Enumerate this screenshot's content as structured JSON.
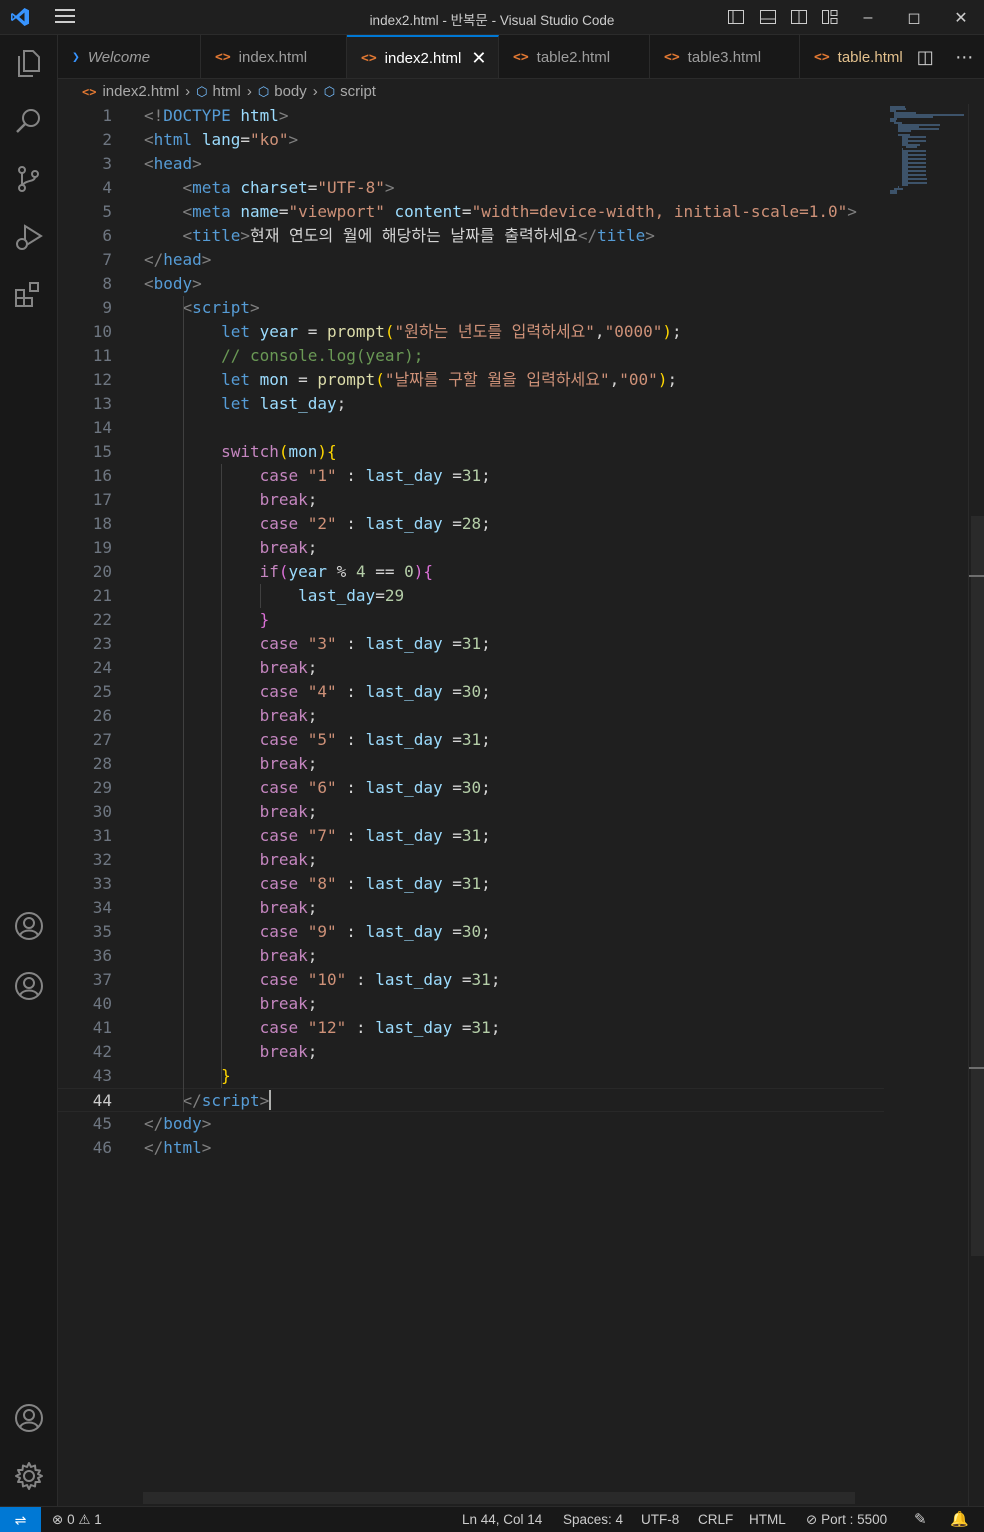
{
  "window": {
    "title": "index2.html - 반복문 - Visual Studio Code"
  },
  "tabs": [
    {
      "label": "Welcome",
      "icon": "vscode-icon"
    },
    {
      "label": "index.html",
      "icon": "html-icon"
    },
    {
      "label": "index2.html",
      "icon": "html-icon",
      "active": true
    },
    {
      "label": "table2.html",
      "icon": "html-icon"
    },
    {
      "label": "table3.html",
      "icon": "html-icon"
    },
    {
      "label": "table.html",
      "icon": "html-icon",
      "modified": true
    }
  ],
  "breadcrumb": [
    "index2.html",
    "html",
    "body",
    "script"
  ],
  "editor": {
    "current_line": 44,
    "line_numbers": [
      "1",
      "2",
      "3",
      "4",
      "5",
      "6",
      "7",
      "8",
      "9",
      "10",
      "11",
      "12",
      "13",
      "14",
      "15",
      "16",
      "17",
      "18",
      "19",
      "20",
      "21",
      "22",
      "23",
      "24",
      "25",
      "26",
      "27",
      "28",
      "29",
      "30",
      "31",
      "32",
      "33",
      "34",
      "35",
      "36",
      "37",
      "40",
      "41",
      "42",
      "43",
      "44",
      "45",
      "46"
    ],
    "lines": [
      [
        [
          "t-br",
          "<!"
        ],
        [
          "t-tag",
          "DOCTYPE "
        ],
        [
          "t-attr",
          "html"
        ],
        [
          "t-br",
          ">"
        ]
      ],
      [
        [
          "t-br",
          "<"
        ],
        [
          "t-tag",
          "html "
        ],
        [
          "t-attr",
          "lang"
        ],
        [
          "t-txt",
          "="
        ],
        [
          "t-str",
          "\"ko\""
        ],
        [
          "t-br",
          ">"
        ]
      ],
      [
        [
          "t-br",
          "<"
        ],
        [
          "t-tag",
          "head"
        ],
        [
          "t-br",
          ">"
        ]
      ],
      [
        [
          "t-txt",
          "    "
        ],
        [
          "t-br",
          "<"
        ],
        [
          "t-tag",
          "meta "
        ],
        [
          "t-attr",
          "charset"
        ],
        [
          "t-txt",
          "="
        ],
        [
          "t-str",
          "\"UTF-8\""
        ],
        [
          "t-br",
          ">"
        ]
      ],
      [
        [
          "t-txt",
          "    "
        ],
        [
          "t-br",
          "<"
        ],
        [
          "t-tag",
          "meta "
        ],
        [
          "t-attr",
          "name"
        ],
        [
          "t-txt",
          "="
        ],
        [
          "t-str",
          "\"viewport\" "
        ],
        [
          "t-attr",
          "content"
        ],
        [
          "t-txt",
          "="
        ],
        [
          "t-str",
          "\"width=device-width, initial-scale=1.0\""
        ],
        [
          "t-br",
          ">"
        ]
      ],
      [
        [
          "t-txt",
          "    "
        ],
        [
          "t-br",
          "<"
        ],
        [
          "t-tag",
          "title"
        ],
        [
          "t-br",
          ">"
        ],
        [
          "t-txt",
          "현재 연도의 월에 해당하는 날짜를 출력하세요"
        ],
        [
          "t-br",
          "</"
        ],
        [
          "t-tag",
          "title"
        ],
        [
          "t-br",
          ">"
        ]
      ],
      [
        [
          "t-br",
          "</"
        ],
        [
          "t-tag",
          "head"
        ],
        [
          "t-br",
          ">"
        ]
      ],
      [
        [
          "t-br",
          "<"
        ],
        [
          "t-tag",
          "body"
        ],
        [
          "t-br",
          ">"
        ]
      ],
      [
        [
          "t-txt",
          "    "
        ],
        [
          "t-br",
          "<"
        ],
        [
          "t-tag",
          "script"
        ],
        [
          "t-br",
          ">"
        ]
      ],
      [
        [
          "t-txt",
          "        "
        ],
        [
          "t-kw",
          "let "
        ],
        [
          "t-var",
          "year "
        ],
        [
          "t-txt",
          "= "
        ],
        [
          "t-fn",
          "prompt"
        ],
        [
          "t-p1",
          "("
        ],
        [
          "t-str",
          "\"원하는 년도를 입력하세요\""
        ],
        [
          "t-txt",
          ","
        ],
        [
          "t-str",
          "\"0000\""
        ],
        [
          "t-p1",
          ")"
        ],
        [
          "t-txt",
          ";"
        ]
      ],
      [
        [
          "t-txt",
          "        "
        ],
        [
          "t-com",
          "// console.log(year);"
        ]
      ],
      [
        [
          "t-txt",
          "        "
        ],
        [
          "t-kw",
          "let "
        ],
        [
          "t-var",
          "mon "
        ],
        [
          "t-txt",
          "= "
        ],
        [
          "t-fn",
          "prompt"
        ],
        [
          "t-p1",
          "("
        ],
        [
          "t-str",
          "\"날짜를 구할 월을 입력하세요\""
        ],
        [
          "t-txt",
          ","
        ],
        [
          "t-str",
          "\"00\""
        ],
        [
          "t-p1",
          ")"
        ],
        [
          "t-txt",
          ";"
        ]
      ],
      [
        [
          "t-txt",
          "        "
        ],
        [
          "t-kw",
          "let "
        ],
        [
          "t-var",
          "last_day"
        ],
        [
          "t-txt",
          ";"
        ]
      ],
      [],
      [
        [
          "t-txt",
          "        "
        ],
        [
          "t-ctl",
          "switch"
        ],
        [
          "t-p1",
          "("
        ],
        [
          "t-var",
          "mon"
        ],
        [
          "t-p1",
          ")"
        ],
        [
          "t-p1",
          "{"
        ]
      ],
      [
        [
          "t-txt",
          "            "
        ],
        [
          "t-ctl",
          "case "
        ],
        [
          "t-str",
          "\"1\" "
        ],
        [
          "t-txt",
          ": "
        ],
        [
          "t-var",
          "last_day "
        ],
        [
          "t-txt",
          "="
        ],
        [
          "t-num",
          "31"
        ],
        [
          "t-txt",
          ";"
        ]
      ],
      [
        [
          "t-txt",
          "            "
        ],
        [
          "t-ctl",
          "break"
        ],
        [
          "t-txt",
          ";"
        ]
      ],
      [
        [
          "t-txt",
          "            "
        ],
        [
          "t-ctl",
          "case "
        ],
        [
          "t-str",
          "\"2\" "
        ],
        [
          "t-txt",
          ": "
        ],
        [
          "t-var",
          "last_day "
        ],
        [
          "t-txt",
          "="
        ],
        [
          "t-num",
          "28"
        ],
        [
          "t-txt",
          ";"
        ]
      ],
      [
        [
          "t-txt",
          "            "
        ],
        [
          "t-ctl",
          "break"
        ],
        [
          "t-txt",
          ";"
        ]
      ],
      [
        [
          "t-txt",
          "            "
        ],
        [
          "t-ctl",
          "if"
        ],
        [
          "t-p2",
          "("
        ],
        [
          "t-var",
          "year "
        ],
        [
          "t-txt",
          "% "
        ],
        [
          "t-num",
          "4 "
        ],
        [
          "t-txt",
          "== "
        ],
        [
          "t-num",
          "0"
        ],
        [
          "t-p2",
          ")"
        ],
        [
          "t-p2",
          "{"
        ]
      ],
      [
        [
          "t-txt",
          "                "
        ],
        [
          "t-var",
          "last_day"
        ],
        [
          "t-txt",
          "="
        ],
        [
          "t-num",
          "29"
        ]
      ],
      [
        [
          "t-txt",
          "            "
        ],
        [
          "t-p2",
          "}"
        ]
      ],
      [
        [
          "t-txt",
          "            "
        ],
        [
          "t-ctl",
          "case "
        ],
        [
          "t-str",
          "\"3\" "
        ],
        [
          "t-txt",
          ": "
        ],
        [
          "t-var",
          "last_day "
        ],
        [
          "t-txt",
          "="
        ],
        [
          "t-num",
          "31"
        ],
        [
          "t-txt",
          ";"
        ]
      ],
      [
        [
          "t-txt",
          "            "
        ],
        [
          "t-ctl",
          "break"
        ],
        [
          "t-txt",
          ";"
        ]
      ],
      [
        [
          "t-txt",
          "            "
        ],
        [
          "t-ctl",
          "case "
        ],
        [
          "t-str",
          "\"4\" "
        ],
        [
          "t-txt",
          ": "
        ],
        [
          "t-var",
          "last_day "
        ],
        [
          "t-txt",
          "="
        ],
        [
          "t-num",
          "30"
        ],
        [
          "t-txt",
          ";"
        ]
      ],
      [
        [
          "t-txt",
          "            "
        ],
        [
          "t-ctl",
          "break"
        ],
        [
          "t-txt",
          ";"
        ]
      ],
      [
        [
          "t-txt",
          "            "
        ],
        [
          "t-ctl",
          "case "
        ],
        [
          "t-str",
          "\"5\" "
        ],
        [
          "t-txt",
          ": "
        ],
        [
          "t-var",
          "last_day "
        ],
        [
          "t-txt",
          "="
        ],
        [
          "t-num",
          "31"
        ],
        [
          "t-txt",
          ";"
        ]
      ],
      [
        [
          "t-txt",
          "            "
        ],
        [
          "t-ctl",
          "break"
        ],
        [
          "t-txt",
          ";"
        ]
      ],
      [
        [
          "t-txt",
          "            "
        ],
        [
          "t-ctl",
          "case "
        ],
        [
          "t-str",
          "\"6\" "
        ],
        [
          "t-txt",
          ": "
        ],
        [
          "t-var",
          "last_day "
        ],
        [
          "t-txt",
          "="
        ],
        [
          "t-num",
          "30"
        ],
        [
          "t-txt",
          ";"
        ]
      ],
      [
        [
          "t-txt",
          "            "
        ],
        [
          "t-ctl",
          "break"
        ],
        [
          "t-txt",
          ";"
        ]
      ],
      [
        [
          "t-txt",
          "            "
        ],
        [
          "t-ctl",
          "case "
        ],
        [
          "t-str",
          "\"7\" "
        ],
        [
          "t-txt",
          ": "
        ],
        [
          "t-var",
          "last_day "
        ],
        [
          "t-txt",
          "="
        ],
        [
          "t-num",
          "31"
        ],
        [
          "t-txt",
          ";"
        ]
      ],
      [
        [
          "t-txt",
          "            "
        ],
        [
          "t-ctl",
          "break"
        ],
        [
          "t-txt",
          ";"
        ]
      ],
      [
        [
          "t-txt",
          "            "
        ],
        [
          "t-ctl",
          "case "
        ],
        [
          "t-str",
          "\"8\" "
        ],
        [
          "t-txt",
          ": "
        ],
        [
          "t-var",
          "last_day "
        ],
        [
          "t-txt",
          "="
        ],
        [
          "t-num",
          "31"
        ],
        [
          "t-txt",
          ";"
        ]
      ],
      [
        [
          "t-txt",
          "            "
        ],
        [
          "t-ctl",
          "break"
        ],
        [
          "t-txt",
          ";"
        ]
      ],
      [
        [
          "t-txt",
          "            "
        ],
        [
          "t-ctl",
          "case "
        ],
        [
          "t-str",
          "\"9\" "
        ],
        [
          "t-txt",
          ": "
        ],
        [
          "t-var",
          "last_day "
        ],
        [
          "t-txt",
          "="
        ],
        [
          "t-num",
          "30"
        ],
        [
          "t-txt",
          ";"
        ]
      ],
      [
        [
          "t-txt",
          "            "
        ],
        [
          "t-ctl",
          "break"
        ],
        [
          "t-txt",
          ";"
        ]
      ],
      [
        [
          "t-txt",
          "            "
        ],
        [
          "t-ctl",
          "case "
        ],
        [
          "t-str",
          "\"10\" "
        ],
        [
          "t-txt",
          ": "
        ],
        [
          "t-var",
          "last_day "
        ],
        [
          "t-txt",
          "="
        ],
        [
          "t-num",
          "31"
        ],
        [
          "t-txt",
          ";"
        ]
      ],
      [
        [
          "t-txt",
          "            "
        ],
        [
          "t-ctl",
          "break"
        ],
        [
          "t-txt",
          ";"
        ]
      ],
      [
        [
          "t-txt",
          "            "
        ],
        [
          "t-ctl",
          "case "
        ],
        [
          "t-str",
          "\"12\" "
        ],
        [
          "t-txt",
          ": "
        ],
        [
          "t-var",
          "last_day "
        ],
        [
          "t-txt",
          "="
        ],
        [
          "t-num",
          "31"
        ],
        [
          "t-txt",
          ";"
        ]
      ],
      [
        [
          "t-txt",
          "            "
        ],
        [
          "t-ctl",
          "break"
        ],
        [
          "t-txt",
          ";"
        ]
      ],
      [
        [
          "t-txt",
          "        "
        ],
        [
          "t-p1",
          "}"
        ]
      ],
      [
        [
          "t-txt",
          "    "
        ],
        [
          "t-br",
          "</"
        ],
        [
          "t-tag",
          "script"
        ],
        [
          "t-br",
          ">"
        ]
      ],
      [
        [
          "t-br",
          "</"
        ],
        [
          "t-tag",
          "body"
        ],
        [
          "t-br",
          ">"
        ]
      ],
      [
        [
          "t-br",
          "</"
        ],
        [
          "t-tag",
          "html"
        ],
        [
          "t-br",
          ">"
        ]
      ]
    ]
  },
  "status": {
    "errors": "0",
    "warnings": "1",
    "position": "Ln 44, Col 14",
    "spaces": "Spaces: 4",
    "encoding": "UTF-8",
    "eol": "CRLF",
    "language": "HTML",
    "port": "Port : 5500"
  },
  "colors": {
    "accent": "#0078d4",
    "background": "#1f1f1f"
  }
}
